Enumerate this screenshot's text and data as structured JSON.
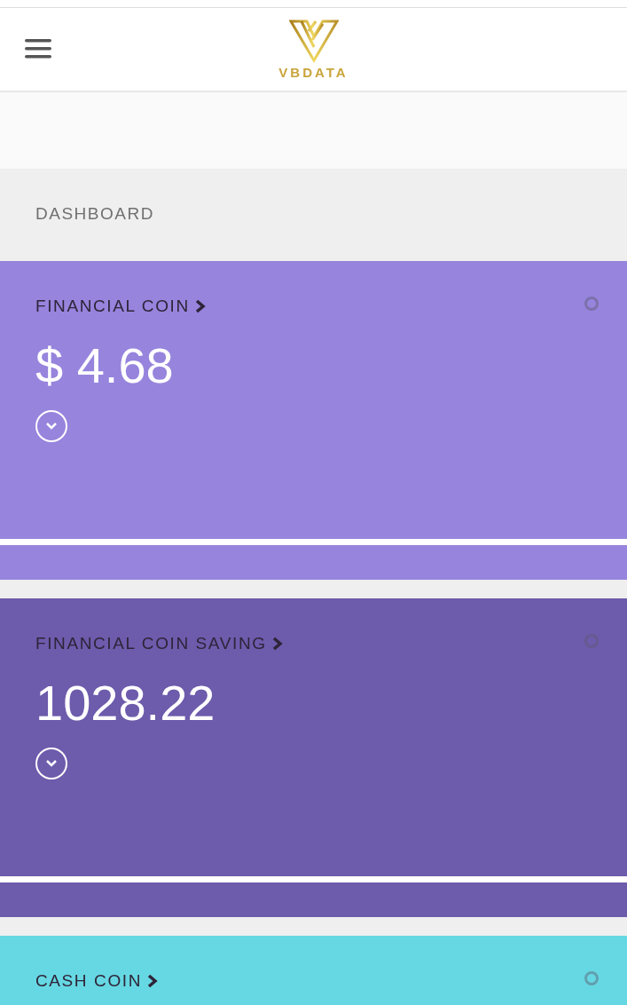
{
  "header": {
    "logo_text": "VBDATA"
  },
  "section_title": "DASHBOARD",
  "cards": [
    {
      "title": "FINANCIAL COIN",
      "value": "$ 4.68",
      "color": "#9784dd"
    },
    {
      "title": "FINANCIAL COIN SAVING",
      "value": "1028.22",
      "color": "#6d5bac"
    },
    {
      "title": "CASH COIN",
      "color": "#66d8e3"
    }
  ]
}
